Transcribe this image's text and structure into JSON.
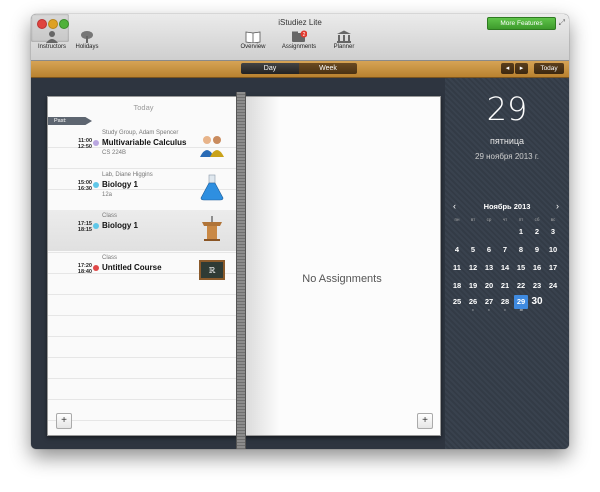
{
  "window": {
    "title": "iStudiez Lite",
    "more_features": "More Features"
  },
  "toolbar": {
    "items": [
      {
        "label": "Instructors"
      },
      {
        "label": "Holidays"
      },
      {
        "label": "Overview"
      },
      {
        "label": "Assignments",
        "badge": "2"
      },
      {
        "label": "Planner"
      }
    ]
  },
  "viewbar": {
    "day": "Day",
    "week": "Week",
    "prev": "◂",
    "next": "▸",
    "today": "Today"
  },
  "day_page": {
    "title": "Today",
    "past_label": "Past:",
    "events": [
      {
        "start": "11:00",
        "end": "12:50",
        "type": "Study Group, Adam Spencer",
        "title": "Multivariable Calculus",
        "room": "CS 224B",
        "color": "#b9a6e0",
        "icon": "people-icon"
      },
      {
        "start": "15:00",
        "end": "16:30",
        "type": "Lab, Diane Higgins",
        "title": "Biology 1",
        "room": "12a",
        "color": "#5fc7e8",
        "icon": "flask-icon"
      },
      {
        "start": "17:15",
        "end": "18:15",
        "type": "Class",
        "title": "Biology 1",
        "room": "",
        "color": "#5fc7e8",
        "icon": "podium-icon"
      },
      {
        "start": "17:20",
        "end": "18:40",
        "type": "Class",
        "title": "Untitled Course",
        "room": "",
        "color": "#e04848",
        "icon": "chalkboard-icon"
      }
    ],
    "add": "+"
  },
  "assignments_page": {
    "empty": "No Assignments",
    "add": "+"
  },
  "calendar": {
    "day_number": "29",
    "weekday": "пятница",
    "full_date": "29 ноября 2013 г.",
    "month": "Ноябрь 2013",
    "prev": "‹",
    "next": "›",
    "dow": [
      "пн",
      "вт",
      "ср",
      "чт",
      "пт",
      "сб",
      "вс"
    ],
    "weeks": [
      [
        "",
        "",
        "",
        "",
        "1",
        "2",
        "3"
      ],
      [
        "4",
        "5",
        "6",
        "7",
        "8",
        "9",
        "10"
      ],
      [
        "11",
        "12",
        "13",
        "14",
        "15",
        "16",
        "17"
      ],
      [
        "18",
        "19",
        "20",
        "21",
        "22",
        "23",
        "24"
      ],
      [
        "25",
        "26",
        "27",
        "28",
        "29",
        "30",
        ""
      ]
    ]
  }
}
